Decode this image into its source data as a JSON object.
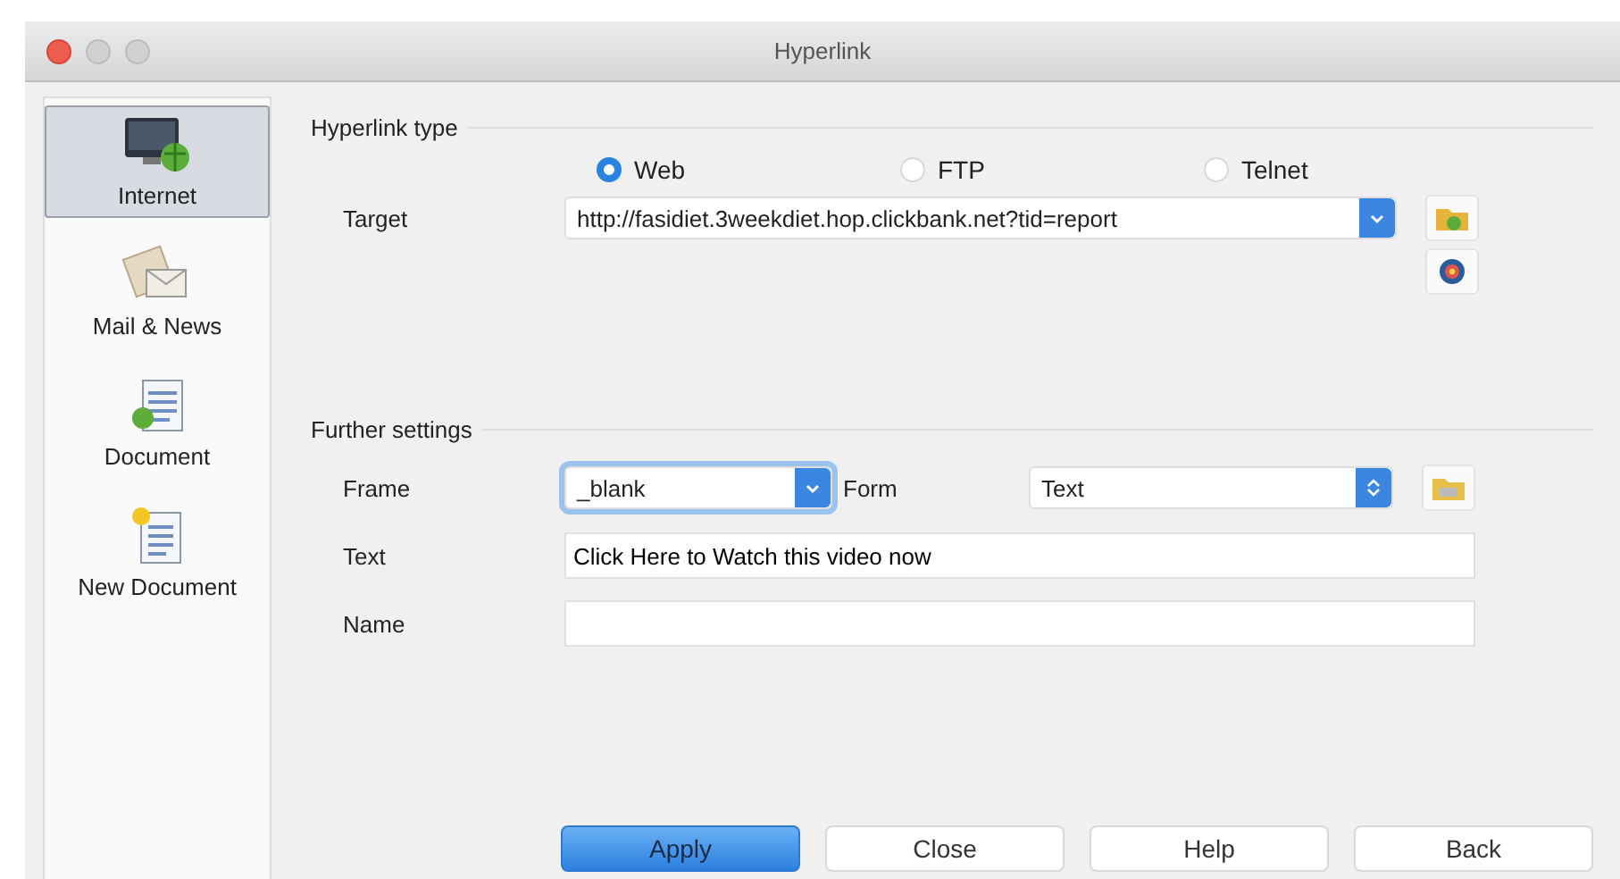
{
  "window": {
    "title": "Hyperlink"
  },
  "sidebar": {
    "items": [
      {
        "label": "Internet",
        "kind": "internet",
        "selected": true
      },
      {
        "label": "Mail & News",
        "kind": "mail",
        "selected": false
      },
      {
        "label": "Document",
        "kind": "document",
        "selected": false
      },
      {
        "label": "New Document",
        "kind": "new-document",
        "selected": false
      }
    ]
  },
  "hyperlink_type": {
    "title": "Hyperlink type",
    "options": [
      {
        "label": "Web",
        "selected": true
      },
      {
        "label": "FTP",
        "selected": false
      },
      {
        "label": "Telnet",
        "selected": false
      }
    ],
    "target": {
      "label": "Target",
      "value": "http://fasidiet.3weekdiet.hop.clickbank.net?tid=report"
    }
  },
  "further_settings": {
    "title": "Further settings",
    "frame": {
      "label": "Frame",
      "value": "_blank"
    },
    "form": {
      "label": "Form",
      "value": "Text"
    },
    "text": {
      "label": "Text",
      "value": "Click Here to Watch this video now"
    },
    "name": {
      "label": "Name"
    }
  },
  "buttons": [
    {
      "label": "Apply",
      "primary": true
    },
    {
      "label": "Close",
      "primary": false
    },
    {
      "label": "Help",
      "primary": false
    },
    {
      "label": "Back",
      "primary": false
    }
  ]
}
